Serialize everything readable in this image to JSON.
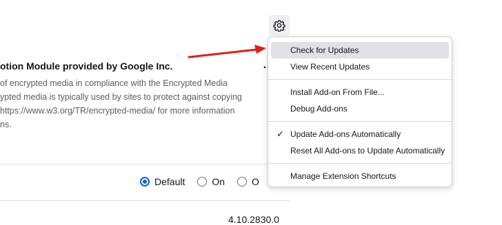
{
  "addon": {
    "title": "otion Module provided by Google Inc.",
    "description_lines": [
      "of encrypted media in compliance with the Encrypted Media",
      "ypted media is typically used by sites to protect against copying",
      " https://www.w3.org/TR/encrypted-media/ for more information",
      "ns."
    ],
    "more_label": "…",
    "update_options": [
      "Default",
      "On",
      "O"
    ],
    "selected_update_option": "Default",
    "version": "4.10.2830.0"
  },
  "menu": {
    "check_updates": "Check for Updates",
    "view_recent": "View Recent Updates",
    "install_from_file": "Install Add-on From File...",
    "debug": "Debug Add-ons",
    "update_auto": "Update Add-ons Automatically",
    "reset_all": "Reset All Add-ons to Update Automatically",
    "manage_shortcuts": "Manage Extension Shortcuts"
  },
  "colors": {
    "annotation_arrow": "#e41a1a",
    "accent": "#0061e0",
    "menu_hover": "#e0e0e6"
  },
  "icons": {
    "gear": "gear-icon",
    "check": "checkmark-icon"
  }
}
